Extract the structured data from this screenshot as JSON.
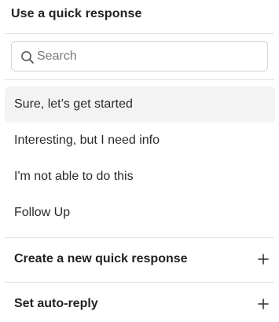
{
  "header": {
    "title": "Use a quick response"
  },
  "search": {
    "placeholder": "Search",
    "value": "",
    "icon": "search-icon"
  },
  "quick_responses": [
    {
      "label": "Sure, let’s get started",
      "highlighted": true
    },
    {
      "label": "Interesting, but I need info",
      "highlighted": false
    },
    {
      "label": "I'm not able to do this",
      "highlighted": false
    },
    {
      "label": "Follow Up",
      "highlighted": false
    }
  ],
  "actions": {
    "create": {
      "label": "Create a new quick response",
      "icon": "plus-icon"
    },
    "auto_reply": {
      "label": "Set auto-reply",
      "icon": "plus-icon"
    }
  },
  "colors": {
    "highlight_bg": "#f3f3f3",
    "divider": "#e4e4e4",
    "border": "#d3d3d3",
    "text": "#222222",
    "placeholder": "#7a7a7a"
  }
}
